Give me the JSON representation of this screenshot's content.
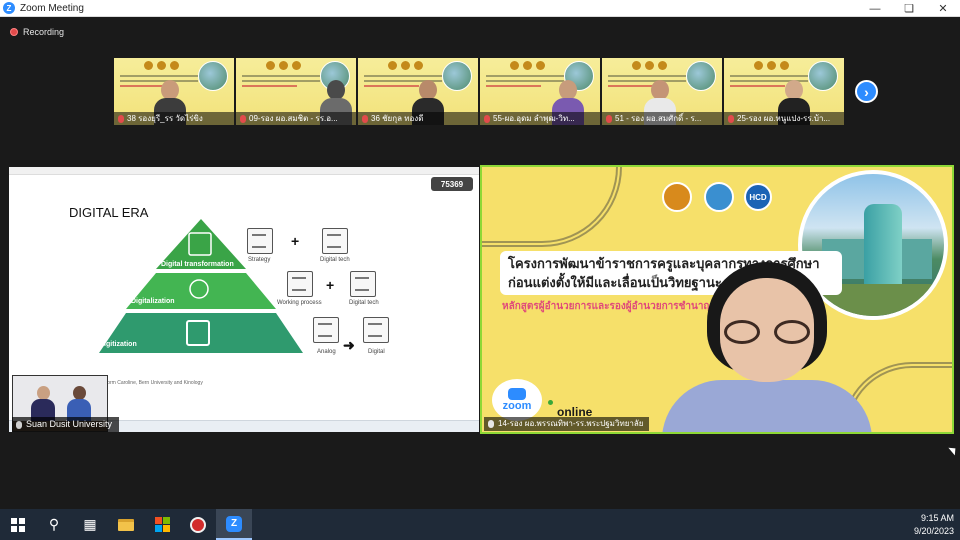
{
  "window": {
    "title": "Zoom Meeting"
  },
  "recording": {
    "label": "Recording"
  },
  "participants": [
    {
      "name": "38 รองยุรี_รร วัดไร่ขิง"
    },
    {
      "name": "09-รอง ผอ.สมชิต - รร.อ..."
    },
    {
      "name": "36 ชัยกุล ทองดี"
    },
    {
      "name": "55-ผอ.อุดม ลำพุฒ-วิท..."
    },
    {
      "name": "51 - รอง ผอ.สมศักดิ์ - ร..."
    },
    {
      "name": "25-รอง ผอ.หนูแปง-รร.บ้า..."
    }
  ],
  "share": {
    "viewer_count": "75369",
    "slide": {
      "title": "DIGITAL ERA",
      "levels": [
        "Digital transformation",
        "Digitalization",
        "Digitization"
      ],
      "flow_labels": [
        "Strategy",
        "Digital tech",
        "Working process",
        "Digital tech",
        "Analog",
        "Digital"
      ],
      "source": "Source: Norm Caroline, Bern University and Kinology"
    }
  },
  "self_view": {
    "name": "Suan Dusit University"
  },
  "speaker": {
    "headline_line1": "โครงการพัฒนาข้าราชการครูและบุคลากรทางการศึกษา",
    "headline_line2": "ก่อนแต่งตั้งให้มีและเลื่อนเป็นวิทยฐานะ",
    "subline": "หลักสูตรผู้อำนวยการและรองผู้อำนวยการชำนาญการพิเศษ",
    "hcd_logo": "HCD",
    "zoom_badge": "zoom",
    "online": "online",
    "name": "14-รอง ผอ.พรรณทิพา-รร.พระปฐมวิทยาลัย"
  },
  "taskbar": {
    "time": "9:15 AM",
    "date": "9/20/2023"
  },
  "colors": {
    "zoom_blue": "#2d8cff",
    "active_speaker_border": "#8ed836",
    "slide_bg_yellow": "#f6e06a",
    "pyramid_top": "#3aa447",
    "pyramid_mid": "#43b552",
    "pyramid_base": "#2f9a6e"
  }
}
